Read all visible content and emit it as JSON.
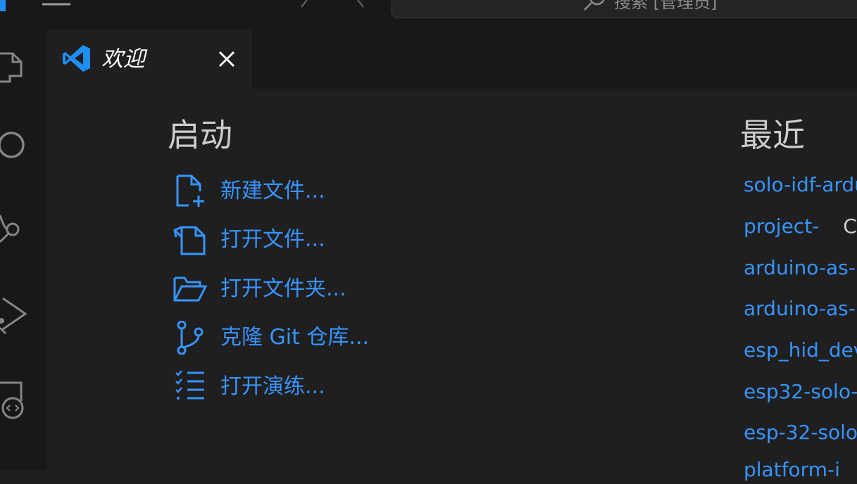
{
  "titlebar": {
    "search_placeholder": "搜索 [管理员]"
  },
  "tab": {
    "label": "欢迎"
  },
  "start": {
    "title": "启动",
    "items": [
      {
        "label": "新建文件...",
        "icon": "new-file-icon"
      },
      {
        "label": "打开文件...",
        "icon": "open-file-icon"
      },
      {
        "label": "打开文件夹...",
        "icon": "open-folder-icon"
      },
      {
        "label": "克隆 Git 仓库...",
        "icon": "git-branch-icon"
      },
      {
        "label": "打开演练...",
        "icon": "checklist-icon"
      }
    ]
  },
  "recent": {
    "title": "最近",
    "items": [
      {
        "name": "solo-idf-arduino",
        "path": ""
      },
      {
        "name": "project-",
        "path": "C"
      },
      {
        "name": "arduino-as-",
        "path": ""
      },
      {
        "name": "arduino-as-",
        "path": ""
      },
      {
        "name": "esp_hid_dev",
        "path": ""
      },
      {
        "name": "esp32-solo-",
        "path": ""
      },
      {
        "name": "esp-32-solo",
        "path": ""
      },
      {
        "name": "platform-i",
        "path": ""
      }
    ]
  },
  "colors": {
    "accent_link": "#3794ff",
    "background": "#1f1f1f",
    "chrome": "#181818",
    "vscode_blue": "#1e8ff0"
  }
}
